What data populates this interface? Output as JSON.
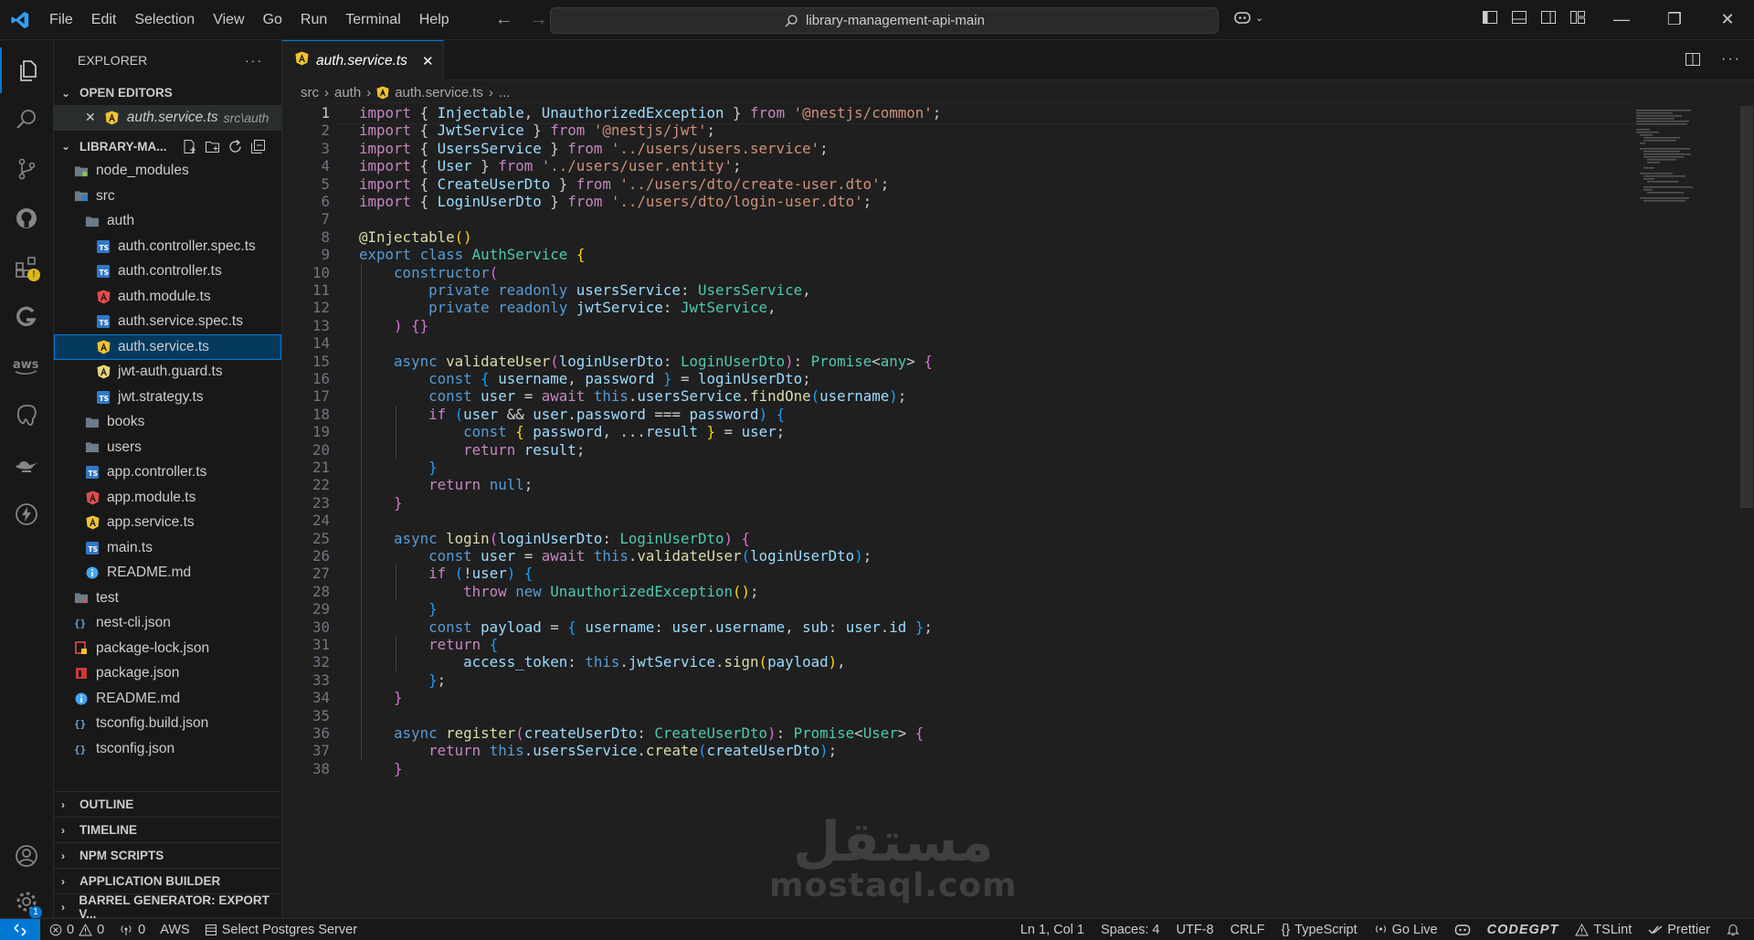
{
  "menu": [
    "File",
    "Edit",
    "Selection",
    "View",
    "Go",
    "Run",
    "Terminal",
    "Help"
  ],
  "search": {
    "text": "library-management-api-main"
  },
  "explorer": {
    "title": "EXPLORER",
    "open_editors": {
      "label": "OPEN EDITORS",
      "items": [
        {
          "name": "auth.service.ts",
          "path": "src\\auth"
        }
      ]
    },
    "project": {
      "label": "LIBRARY-MA..."
    },
    "tree": [
      {
        "name": "node_modules",
        "depth": 1,
        "kind": "folder-green"
      },
      {
        "name": "src",
        "depth": 1,
        "kind": "folder-src"
      },
      {
        "name": "auth",
        "depth": 2,
        "kind": "folder"
      },
      {
        "name": "auth.controller.spec.ts",
        "depth": 3,
        "kind": "ts"
      },
      {
        "name": "auth.controller.ts",
        "depth": 3,
        "kind": "ts"
      },
      {
        "name": "auth.module.ts",
        "depth": 3,
        "kind": "ng-red"
      },
      {
        "name": "auth.service.spec.ts",
        "depth": 3,
        "kind": "ts"
      },
      {
        "name": "auth.service.ts",
        "depth": 3,
        "kind": "ng-yellow",
        "selected": true
      },
      {
        "name": "jwt-auth.guard.ts",
        "depth": 3,
        "kind": "ng-light"
      },
      {
        "name": "jwt.strategy.ts",
        "depth": 3,
        "kind": "ts"
      },
      {
        "name": "books",
        "depth": 2,
        "kind": "folder"
      },
      {
        "name": "users",
        "depth": 2,
        "kind": "folder"
      },
      {
        "name": "app.controller.ts",
        "depth": 2,
        "kind": "ts"
      },
      {
        "name": "app.module.ts",
        "depth": 2,
        "kind": "ng-red"
      },
      {
        "name": "app.service.ts",
        "depth": 2,
        "kind": "ng-yellow"
      },
      {
        "name": "main.ts",
        "depth": 2,
        "kind": "ts"
      },
      {
        "name": "README.md",
        "depth": 2,
        "kind": "info"
      },
      {
        "name": "test",
        "depth": 1,
        "kind": "folder-test"
      },
      {
        "name": "nest-cli.json",
        "depth": 1,
        "kind": "json"
      },
      {
        "name": "package-lock.json",
        "depth": 1,
        "kind": "lock"
      },
      {
        "name": "package.json",
        "depth": 1,
        "kind": "npm"
      },
      {
        "name": "README.md",
        "depth": 1,
        "kind": "info"
      },
      {
        "name": "tsconfig.build.json",
        "depth": 1,
        "kind": "json"
      },
      {
        "name": "tsconfig.json",
        "depth": 1,
        "kind": "json"
      }
    ],
    "sections": [
      "OUTLINE",
      "TIMELINE",
      "NPM SCRIPTS",
      "APPLICATION BUILDER",
      "BARREL GENERATOR: EXPORT V..."
    ]
  },
  "tab": {
    "name": "auth.service.ts"
  },
  "breadcrumb": [
    "src",
    "auth",
    "auth.service.ts",
    "..."
  ],
  "code_lines": [
    [
      [
        "kw",
        "import"
      ],
      [
        "",
        "{ "
      ],
      [
        "vr",
        "Injectable"
      ],
      [
        "",
        ", "
      ],
      [
        "vr",
        "UnauthorizedException"
      ],
      [
        "",
        " } "
      ],
      [
        "kw",
        "from"
      ],
      [
        "",
        " "
      ],
      [
        "st",
        "'@nestjs/common'"
      ],
      [
        "",
        ";"
      ]
    ],
    [
      [
        "kw",
        "import"
      ],
      [
        "",
        "{ "
      ],
      [
        "vr",
        "JwtService"
      ],
      [
        "",
        " } "
      ],
      [
        "kw",
        "from"
      ],
      [
        "",
        " "
      ],
      [
        "st",
        "'@nestjs/jwt'"
      ],
      [
        "",
        ";"
      ]
    ],
    [
      [
        "kw",
        "import"
      ],
      [
        "",
        "{ "
      ],
      [
        "vr",
        "UsersService"
      ],
      [
        "",
        " } "
      ],
      [
        "kw",
        "from"
      ],
      [
        "",
        " "
      ],
      [
        "st",
        "'../users/users.service'"
      ],
      [
        "",
        ";"
      ]
    ],
    [
      [
        "kw",
        "import"
      ],
      [
        "",
        "{ "
      ],
      [
        "vr",
        "User"
      ],
      [
        "",
        " } "
      ],
      [
        "kw",
        "from"
      ],
      [
        "",
        " "
      ],
      [
        "st",
        "'../users/user.entity'"
      ],
      [
        "",
        ";"
      ]
    ],
    [
      [
        "kw",
        "import"
      ],
      [
        "",
        "{ "
      ],
      [
        "vr",
        "CreateUserDto"
      ],
      [
        "",
        " } "
      ],
      [
        "kw",
        "from"
      ],
      [
        "",
        " "
      ],
      [
        "st",
        "'../users/dto/create-user.dto'"
      ],
      [
        "",
        ";"
      ]
    ],
    [
      [
        "kw",
        "import"
      ],
      [
        "",
        "{ "
      ],
      [
        "vr",
        "LoginUserDto"
      ],
      [
        "",
        " } "
      ],
      [
        "kw",
        "from"
      ],
      [
        "",
        " "
      ],
      [
        "st",
        "'../users/dto/login-user.dto'"
      ],
      [
        "",
        ";"
      ]
    ],
    [],
    [
      [
        "fn",
        "@Injectable"
      ],
      [
        "b1",
        "()"
      ]
    ],
    [
      [
        "bl",
        "export"
      ],
      [
        "",
        " "
      ],
      [
        "bl",
        "class"
      ],
      [
        "",
        " "
      ],
      [
        "ty",
        "AuthService"
      ],
      [
        "",
        " "
      ],
      [
        "b1",
        "{"
      ]
    ],
    [
      [
        "",
        "    "
      ],
      [
        "bl",
        "constructor"
      ],
      [
        "b2",
        "("
      ]
    ],
    [
      [
        "",
        "        "
      ],
      [
        "bl",
        "private"
      ],
      [
        "",
        " "
      ],
      [
        "bl",
        "readonly"
      ],
      [
        "",
        " "
      ],
      [
        "vr",
        "usersService"
      ],
      [
        "",
        ": "
      ],
      [
        "ty",
        "UsersService"
      ],
      [
        "",
        ","
      ]
    ],
    [
      [
        "",
        "        "
      ],
      [
        "bl",
        "private"
      ],
      [
        "",
        " "
      ],
      [
        "bl",
        "readonly"
      ],
      [
        "",
        " "
      ],
      [
        "vr",
        "jwtService"
      ],
      [
        "",
        ": "
      ],
      [
        "ty",
        "JwtService"
      ],
      [
        "",
        ","
      ]
    ],
    [
      [
        "",
        "    "
      ],
      [
        "b2",
        ")"
      ],
      [
        "",
        " "
      ],
      [
        "b2",
        "{}"
      ]
    ],
    [],
    [
      [
        "",
        "    "
      ],
      [
        "bl",
        "async"
      ],
      [
        "",
        " "
      ],
      [
        "fn",
        "validateUser"
      ],
      [
        "b2",
        "("
      ],
      [
        "vr",
        "loginUserDto"
      ],
      [
        "",
        ": "
      ],
      [
        "ty",
        "LoginUserDto"
      ],
      [
        "b2",
        ")"
      ],
      [
        "",
        ": "
      ],
      [
        "ty",
        "Promise"
      ],
      [
        "",
        "<"
      ],
      [
        "ty",
        "any"
      ],
      [
        "",
        "> "
      ],
      [
        "b2",
        "{"
      ]
    ],
    [
      [
        "",
        "        "
      ],
      [
        "bl",
        "const"
      ],
      [
        "",
        " "
      ],
      [
        "b3",
        "{"
      ],
      [
        "",
        " "
      ],
      [
        "vr",
        "username"
      ],
      [
        "",
        ", "
      ],
      [
        "vr",
        "password"
      ],
      [
        "",
        " "
      ],
      [
        "b3",
        "}"
      ],
      [
        "",
        " = "
      ],
      [
        "vr",
        "loginUserDto"
      ],
      [
        "",
        ";"
      ]
    ],
    [
      [
        "",
        "        "
      ],
      [
        "bl",
        "const"
      ],
      [
        "",
        " "
      ],
      [
        "vr",
        "user"
      ],
      [
        "",
        " = "
      ],
      [
        "kw",
        "await"
      ],
      [
        "",
        " "
      ],
      [
        "bl",
        "this"
      ],
      [
        "",
        "."
      ],
      [
        "vr",
        "usersService"
      ],
      [
        "",
        "."
      ],
      [
        "fn",
        "findOne"
      ],
      [
        "b3",
        "("
      ],
      [
        "vr",
        "username"
      ],
      [
        "b3",
        ")"
      ],
      [
        "",
        ";"
      ]
    ],
    [
      [
        "",
        "        "
      ],
      [
        "kw",
        "if"
      ],
      [
        "",
        " "
      ],
      [
        "b3",
        "("
      ],
      [
        "vr",
        "user"
      ],
      [
        "",
        " && "
      ],
      [
        "vr",
        "user"
      ],
      [
        "",
        "."
      ],
      [
        "vr",
        "password"
      ],
      [
        "",
        " === "
      ],
      [
        "vr",
        "password"
      ],
      [
        "b3",
        ")"
      ],
      [
        "",
        " "
      ],
      [
        "b3",
        "{"
      ]
    ],
    [
      [
        "",
        "            "
      ],
      [
        "bl",
        "const"
      ],
      [
        "",
        " "
      ],
      [
        "b1",
        "{"
      ],
      [
        "",
        " "
      ],
      [
        "vr",
        "password"
      ],
      [
        "",
        ", ..."
      ],
      [
        "vr",
        "result"
      ],
      [
        "",
        " "
      ],
      [
        "b1",
        "}"
      ],
      [
        "",
        " = "
      ],
      [
        "vr",
        "user"
      ],
      [
        "",
        ";"
      ]
    ],
    [
      [
        "",
        "            "
      ],
      [
        "kw",
        "return"
      ],
      [
        "",
        " "
      ],
      [
        "vr",
        "result"
      ],
      [
        "",
        ";"
      ]
    ],
    [
      [
        "",
        "        "
      ],
      [
        "b3",
        "}"
      ]
    ],
    [
      [
        "",
        "        "
      ],
      [
        "kw",
        "return"
      ],
      [
        "",
        " "
      ],
      [
        "bl",
        "null"
      ],
      [
        "",
        ";"
      ]
    ],
    [
      [
        "",
        "    "
      ],
      [
        "b2",
        "}"
      ]
    ],
    [],
    [
      [
        "",
        "    "
      ],
      [
        "bl",
        "async"
      ],
      [
        "",
        " "
      ],
      [
        "fn",
        "login"
      ],
      [
        "b2",
        "("
      ],
      [
        "vr",
        "loginUserDto"
      ],
      [
        "",
        ": "
      ],
      [
        "ty",
        "LoginUserDto"
      ],
      [
        "b2",
        ")"
      ],
      [
        "",
        " "
      ],
      [
        "b2",
        "{"
      ]
    ],
    [
      [
        "",
        "        "
      ],
      [
        "bl",
        "const"
      ],
      [
        "",
        " "
      ],
      [
        "vr",
        "user"
      ],
      [
        "",
        " = "
      ],
      [
        "kw",
        "await"
      ],
      [
        "",
        " "
      ],
      [
        "bl",
        "this"
      ],
      [
        "",
        "."
      ],
      [
        "fn",
        "validateUser"
      ],
      [
        "b3",
        "("
      ],
      [
        "vr",
        "loginUserDto"
      ],
      [
        "b3",
        ")"
      ],
      [
        "",
        ";"
      ]
    ],
    [
      [
        "",
        "        "
      ],
      [
        "kw",
        "if"
      ],
      [
        "",
        " "
      ],
      [
        "b3",
        "("
      ],
      [
        "",
        "!"
      ],
      [
        "vr",
        "user"
      ],
      [
        "b3",
        ")"
      ],
      [
        "",
        " "
      ],
      [
        "b3",
        "{"
      ]
    ],
    [
      [
        "",
        "            "
      ],
      [
        "kw",
        "throw"
      ],
      [
        "",
        " "
      ],
      [
        "bl",
        "new"
      ],
      [
        "",
        " "
      ],
      [
        "ty",
        "UnauthorizedException"
      ],
      [
        "b1",
        "()"
      ],
      [
        "",
        ";"
      ]
    ],
    [
      [
        "",
        "        "
      ],
      [
        "b3",
        "}"
      ]
    ],
    [
      [
        "",
        "        "
      ],
      [
        "bl",
        "const"
      ],
      [
        "",
        " "
      ],
      [
        "vr",
        "payload"
      ],
      [
        "",
        " = "
      ],
      [
        "b3",
        "{"
      ],
      [
        "",
        " "
      ],
      [
        "vr",
        "username"
      ],
      [
        "",
        ": "
      ],
      [
        "vr",
        "user"
      ],
      [
        "",
        "."
      ],
      [
        "vr",
        "username"
      ],
      [
        "",
        ", "
      ],
      [
        "vr",
        "sub"
      ],
      [
        "",
        ": "
      ],
      [
        "vr",
        "user"
      ],
      [
        "",
        "."
      ],
      [
        "vr",
        "id"
      ],
      [
        "",
        " "
      ],
      [
        "b3",
        "}"
      ],
      [
        "",
        ";"
      ]
    ],
    [
      [
        "",
        "        "
      ],
      [
        "kw",
        "return"
      ],
      [
        "",
        " "
      ],
      [
        "b3",
        "{"
      ]
    ],
    [
      [
        "",
        "            "
      ],
      [
        "vr",
        "access_token"
      ],
      [
        "",
        ": "
      ],
      [
        "bl",
        "this"
      ],
      [
        "",
        "."
      ],
      [
        "vr",
        "jwtService"
      ],
      [
        "",
        "."
      ],
      [
        "fn",
        "sign"
      ],
      [
        "b1",
        "("
      ],
      [
        "vr",
        "payload"
      ],
      [
        "b1",
        ")"
      ],
      [
        "",
        ","
      ]
    ],
    [
      [
        "",
        "        "
      ],
      [
        "b3",
        "}"
      ],
      [
        "",
        ";"
      ]
    ],
    [
      [
        "",
        "    "
      ],
      [
        "b2",
        "}"
      ]
    ],
    [],
    [
      [
        "",
        "    "
      ],
      [
        "bl",
        "async"
      ],
      [
        "",
        " "
      ],
      [
        "fn",
        "register"
      ],
      [
        "b2",
        "("
      ],
      [
        "vr",
        "createUserDto"
      ],
      [
        "",
        ": "
      ],
      [
        "ty",
        "CreateUserDto"
      ],
      [
        "b2",
        ")"
      ],
      [
        "",
        ": "
      ],
      [
        "ty",
        "Promise"
      ],
      [
        "",
        "<"
      ],
      [
        "ty",
        "User"
      ],
      [
        "",
        "> "
      ],
      [
        "b2",
        "{"
      ]
    ],
    [
      [
        "",
        "        "
      ],
      [
        "kw",
        "return"
      ],
      [
        "",
        " "
      ],
      [
        "bl",
        "this"
      ],
      [
        "",
        "."
      ],
      [
        "vr",
        "usersService"
      ],
      [
        "",
        "."
      ],
      [
        "fn",
        "create"
      ],
      [
        "b3",
        "("
      ],
      [
        "vr",
        "createUserDto"
      ],
      [
        "b3",
        ")"
      ],
      [
        "",
        ";"
      ]
    ],
    [
      [
        "",
        "    "
      ],
      [
        "b2",
        "}"
      ]
    ]
  ],
  "watermark": {
    "arabic": "مستقل",
    "latin": "mostaql.com"
  },
  "status": {
    "errors": "0",
    "warnings": "0",
    "ports": "0",
    "aws": "AWS",
    "postgres": "Select Postgres Server",
    "position": "Ln 1, Col 1",
    "spaces": "Spaces: 4",
    "encoding": "UTF-8",
    "eol": "CRLF",
    "language": "TypeScript",
    "golive": "Go Live",
    "codegpt": "CODEGPT",
    "tslint": "TSLint",
    "prettier": "Prettier"
  },
  "badges": {
    "extensions": "!",
    "settings": "1"
  },
  "colors": {
    "accent": "#0078d4",
    "selection": "#04395e",
    "angular_red": "#e34c4c",
    "angular_yellow": "#f0c330",
    "ts_blue": "#3178c6"
  }
}
